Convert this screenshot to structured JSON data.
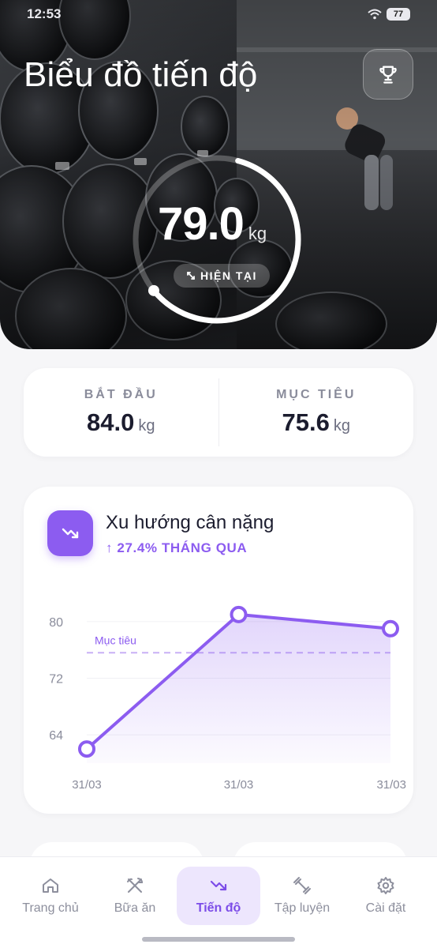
{
  "status": {
    "time": "12:53",
    "battery": "77"
  },
  "hero": {
    "title": "Biểu đồ tiến độ",
    "current_value": "79.0",
    "current_unit": "kg",
    "current_label": "HIỆN TẠI",
    "progress_fraction": 0.6
  },
  "stats": {
    "start": {
      "label": "BẮT ĐẦU",
      "value": "84.0",
      "unit": "kg"
    },
    "goal": {
      "label": "MỤC TIÊU",
      "value": "75.6",
      "unit": "kg"
    }
  },
  "trend": {
    "title": "Xu hướng cân nặng",
    "subtitle": "↑ 27.4% THÁNG QUA",
    "goal_line_label": "Mục tiêu"
  },
  "chart_data": {
    "type": "line",
    "x": [
      "31/03",
      "31/03",
      "31/03"
    ],
    "y_ticks": [
      "80",
      "72",
      "64"
    ],
    "series": [
      {
        "values": [
          62,
          81,
          79
        ]
      }
    ],
    "goal_value": 75.6,
    "ylim": [
      60,
      84
    ],
    "grid": true
  },
  "nav": {
    "items": [
      {
        "label": "Trang chủ",
        "icon": "home-icon"
      },
      {
        "label": "Bữa ăn",
        "icon": "utensils-icon"
      },
      {
        "label": "Tiến độ",
        "icon": "trend-down-icon"
      },
      {
        "label": "Tập luyện",
        "icon": "dumbbell-icon"
      },
      {
        "label": "Cài đặt",
        "icon": "gear-icon"
      }
    ],
    "active_index": 2
  },
  "colors": {
    "accent": "#8c5cf0",
    "background": "#f6f6f8"
  }
}
